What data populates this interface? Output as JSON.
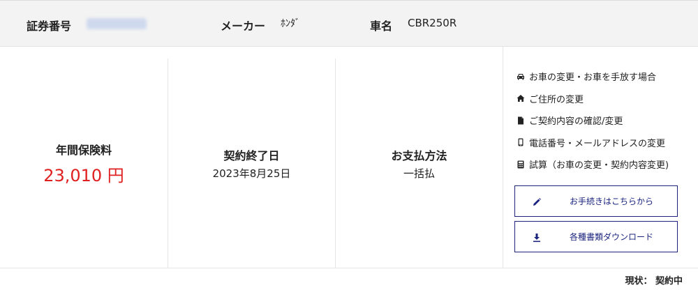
{
  "header": {
    "policy_label": "証券番号",
    "maker_label": "メーカー",
    "maker_value": "ﾎﾝﾀﾞ",
    "car_label": "車名",
    "car_value": "CBR250R"
  },
  "summary": {
    "premium_label": "年間保険料",
    "premium_value": "23,010 円",
    "end_label": "契約終了日",
    "end_value": "2023年8月25日",
    "payment_label": "お支払方法",
    "payment_value": "一括払"
  },
  "links": [
    {
      "label": "お車の変更・お車を手放す場合",
      "icon": "car-icon"
    },
    {
      "label": "ご住所の変更",
      "icon": "home-icon"
    },
    {
      "label": "ご契約内容の確認/変更",
      "icon": "document-icon"
    },
    {
      "label": "電話番号・メールアドレスの変更",
      "icon": "phone-icon"
    },
    {
      "label": "試算（お車の変更・契約内容変更)",
      "icon": "calculator-icon"
    }
  ],
  "buttons": {
    "procedure_label": "お手続きはこちらから",
    "download_label": "各種書類ダウンロード"
  },
  "status": "現状： 契約中",
  "colors": {
    "accent": "#1a237e",
    "price": "#e02020",
    "header_bg": "#f3f3f3"
  }
}
